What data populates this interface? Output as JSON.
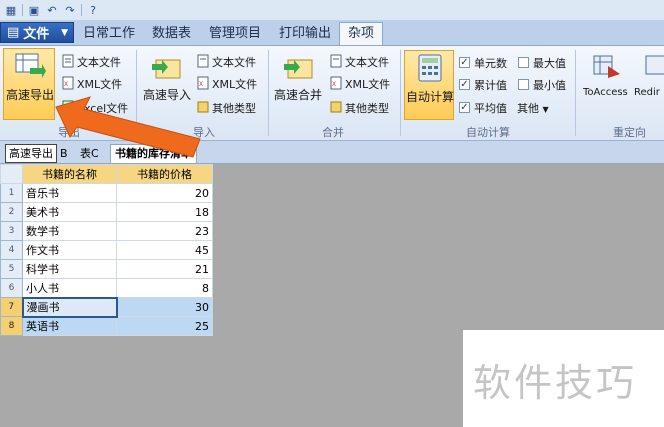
{
  "quick_access": {
    "icons": [
      "app-icon",
      "save-icon",
      "undo-icon",
      "redo-icon",
      "help-icon"
    ]
  },
  "menu": {
    "file_label": "文件",
    "tabs": [
      "日常工作",
      "数据表",
      "管理项目",
      "打印输出",
      "杂项"
    ],
    "active_tab": "杂项"
  },
  "ribbon": {
    "export_group": {
      "big_button": "高速导出",
      "items": [
        "文本文件",
        "XML文件",
        "Excel文件"
      ],
      "label": "导出"
    },
    "import_group": {
      "big_button": "高速导入",
      "items": [
        "文本文件",
        "XML文件",
        "其他类型"
      ],
      "label": "导入"
    },
    "merge_group": {
      "big_button": "高速合并",
      "items": [
        "文本文件",
        "XML文件",
        "其他类型"
      ],
      "label": "合并"
    },
    "calc_group": {
      "big_button": "自动计算",
      "checks": [
        {
          "label": "单元数",
          "checked": true
        },
        {
          "label": "最大值",
          "checked": false
        },
        {
          "label": "累计值",
          "checked": true
        },
        {
          "label": "最小值",
          "checked": false
        },
        {
          "label": "平均值",
          "checked": true
        }
      ],
      "other": "其他",
      "label": "自动计算"
    },
    "redirect_group": {
      "buttons": [
        "ToAccess",
        "Redir"
      ],
      "label": "重定向"
    }
  },
  "tooltip": "高速导出",
  "sheet_tabs": {
    "tab_b": "B",
    "tab_c": "表C",
    "active": "书籍的库存清单"
  },
  "grid": {
    "columns": [
      "书籍的名称",
      "书籍的价格"
    ],
    "rows": [
      {
        "n": "1",
        "name": "音乐书",
        "price": "20"
      },
      {
        "n": "2",
        "name": "美术书",
        "price": "18"
      },
      {
        "n": "3",
        "name": "数学书",
        "price": "23"
      },
      {
        "n": "4",
        "name": "作文书",
        "price": "45"
      },
      {
        "n": "5",
        "name": "科学书",
        "price": "21"
      },
      {
        "n": "6",
        "name": "小人书",
        "price": "8"
      },
      {
        "n": "7",
        "name": "漫画书",
        "price": "30"
      },
      {
        "n": "8",
        "name": "英语书",
        "price": "25"
      }
    ]
  },
  "watermark": "软件技巧",
  "colors": {
    "accent": "#2b5797",
    "highlight": "#ffcc55",
    "arrow": "#f06a1e"
  }
}
